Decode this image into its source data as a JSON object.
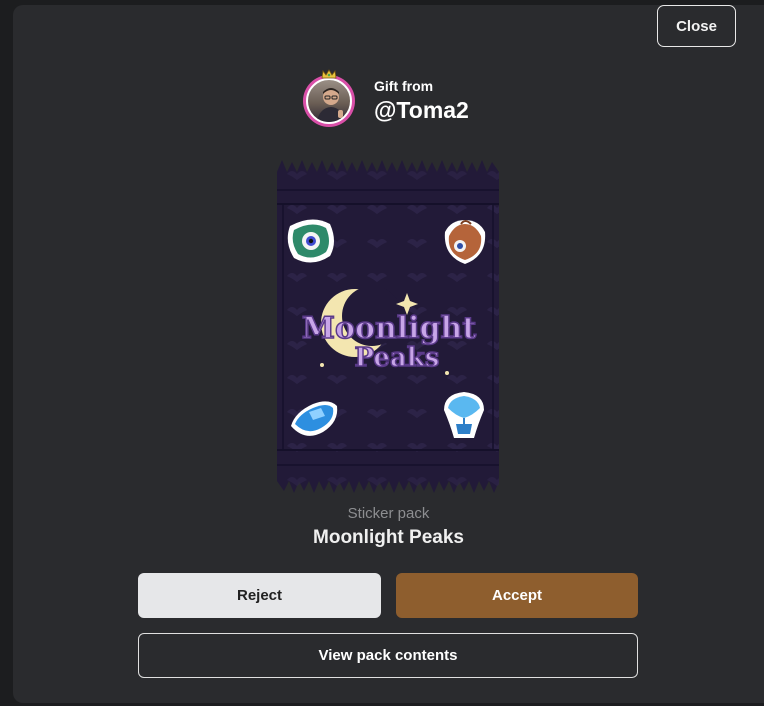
{
  "header": {
    "close_label": "Close"
  },
  "sender": {
    "gift_from_label": "Gift from",
    "username": "@Toma2",
    "avatar_icon": "user-avatar-icon",
    "crown_icon": "crown-icon"
  },
  "pack": {
    "logo_line1": "Moonlight",
    "logo_line2": "Peaks",
    "type_label": "Sticker pack",
    "name": "Moonlight Peaks",
    "stickers": [
      "eye-plant-sticker",
      "eye-pouch-sticker",
      "blue-crystal-sticker",
      "blue-flower-pot-sticker"
    ]
  },
  "actions": {
    "reject_label": "Reject",
    "accept_label": "Accept",
    "view_contents_label": "View pack contents"
  },
  "colors": {
    "modal_bg": "#2a2b2e",
    "accept": "#8e5e2e",
    "reject": "#e6e7e9",
    "pack_bg": "#221a38",
    "avatar_ring": "#d94fa8"
  }
}
